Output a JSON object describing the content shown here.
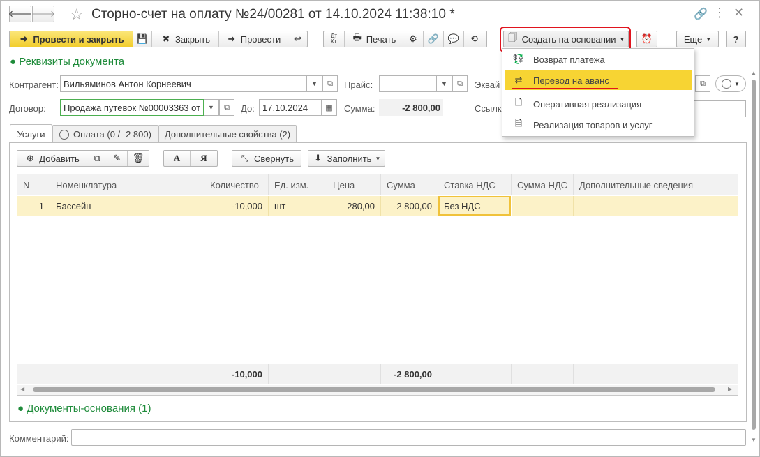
{
  "window": {
    "title": "Сторно-счет на оплату №24/00281 от 14.10.2024 11:38:10 *",
    "back_icon": "arrow-left-icon",
    "forward_icon": "arrow-right-icon"
  },
  "toolbar": {
    "post_close": "Провести и закрыть",
    "close": "Закрыть",
    "post": "Провести",
    "print": "Печать",
    "create_based": "Создать на основании",
    "more": "Еще",
    "help": "?"
  },
  "section": {
    "requisites": "● Реквизиты документа",
    "documents_base": "● Документы-основания (1)"
  },
  "fields": {
    "counterparty_label": "Контрагент:",
    "counterparty_value": "Вильяминов Антон Корнеевич",
    "price_label": "Прайс:",
    "price_value": "",
    "acquiring_label": "Эквай",
    "contract_label": "Договор:",
    "contract_value": "Продажа путевок №00003363 от",
    "to_label": "До:",
    "to_value": "17.10.2024",
    "sum_label": "Сумма:",
    "sum_value": "-2 800,00",
    "link_label": "Ссылк",
    "comment_label": "Комментарий:",
    "comment_value": ""
  },
  "tabs": [
    {
      "label": "Услуги"
    },
    {
      "label": "Оплата (0 / -2 800)"
    },
    {
      "label": "Дополнительные свойства (2)"
    }
  ],
  "table_toolbar": {
    "add": "Добавить",
    "font_a": "А",
    "font_ya": "Я",
    "collapse": "Свернуть",
    "fill": "Заполнить"
  },
  "table": {
    "headers": [
      "N",
      "Номенклатура",
      "Количество",
      "Ед. изм.",
      "Цена",
      "Сумма",
      "Ставка НДС",
      "Сумма НДС",
      "Дополнительные сведения"
    ],
    "rows": [
      {
        "n": "1",
        "name": "Бассейн",
        "qty": "-10,000",
        "unit": "шт",
        "price": "280,00",
        "sum": "-2 800,00",
        "vat_rate": "Без НДС",
        "vat_sum": "",
        "extra": ""
      }
    ],
    "footer": {
      "qty": "-10,000",
      "sum": "-2 800,00"
    }
  },
  "dropdown": {
    "items": [
      {
        "label": "Возврат платежа",
        "icon": "cash-return-icon"
      },
      {
        "label": "Перевод на аванс",
        "icon": "advance-transfer-icon"
      },
      {
        "label": "Оперативная реализация",
        "icon": "document-plus-icon"
      },
      {
        "label": "Реализация товаров и услуг",
        "icon": "document-icon"
      }
    ]
  },
  "colors": {
    "accent_yellow": "#f5d94a",
    "highlight_red": "#e0141e",
    "link_green": "#1e8b3a",
    "selected_row": "#fcf2c8"
  }
}
